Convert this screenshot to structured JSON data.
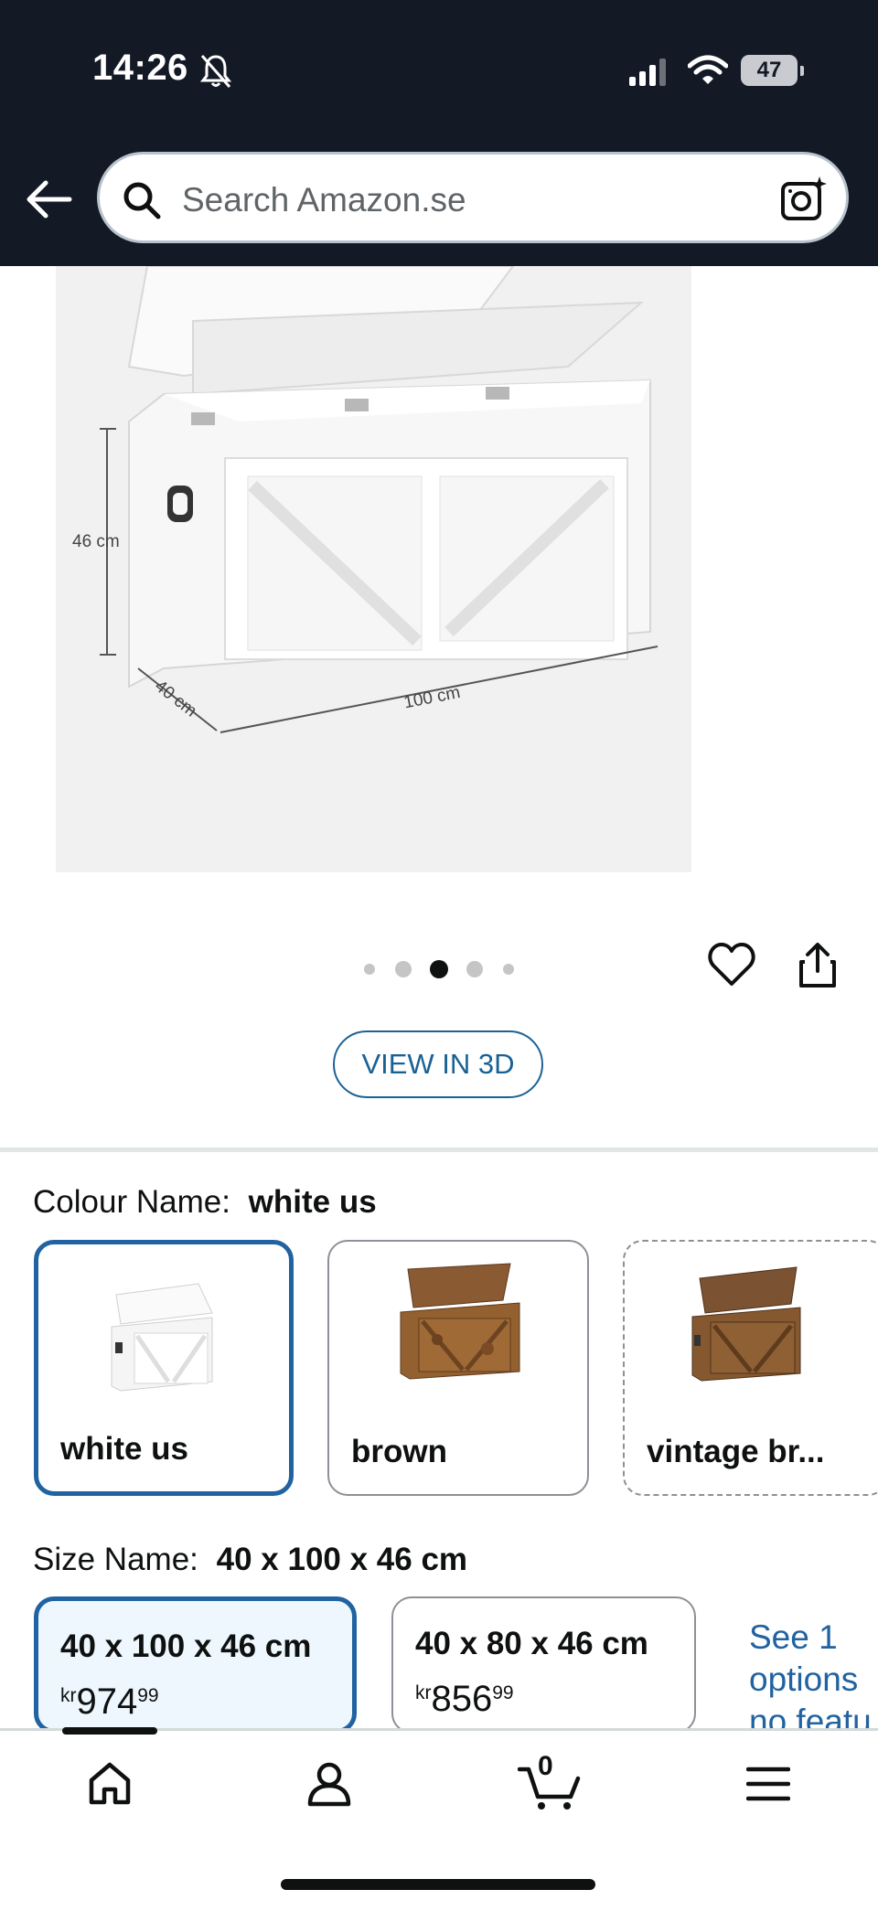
{
  "status_bar": {
    "time": "14:26",
    "battery": "47"
  },
  "header": {
    "search_placeholder": "Search Amazon.se"
  },
  "product_image": {
    "dim_height": "46 cm",
    "dim_depth": "40 cm",
    "dim_width": "100 cm",
    "carousel_total": 5,
    "carousel_active": 3
  },
  "view_3d_label": "VIEW IN 3D",
  "colour": {
    "label": "Colour Name:",
    "selected": "white us",
    "options": [
      {
        "name": "white us"
      },
      {
        "name": "brown"
      },
      {
        "name": "vintage br..."
      }
    ]
  },
  "size": {
    "label": "Size Name:",
    "selected": "40 x 100 x 46 cm",
    "options": [
      {
        "dim": "40 x 100 x 46 cm",
        "currency": "kr",
        "price_main": "974",
        "price_cents": "99"
      },
      {
        "dim": "40 x 80 x 46 cm",
        "currency": "kr",
        "price_main": "856",
        "price_cents": "99"
      }
    ],
    "see_more": "See 1 options no featu"
  },
  "bottom_nav": {
    "cart_count": "0"
  },
  "colors": {
    "accent": "#2162a1",
    "header_bg": "#131a26",
    "link": "#1a6294"
  }
}
